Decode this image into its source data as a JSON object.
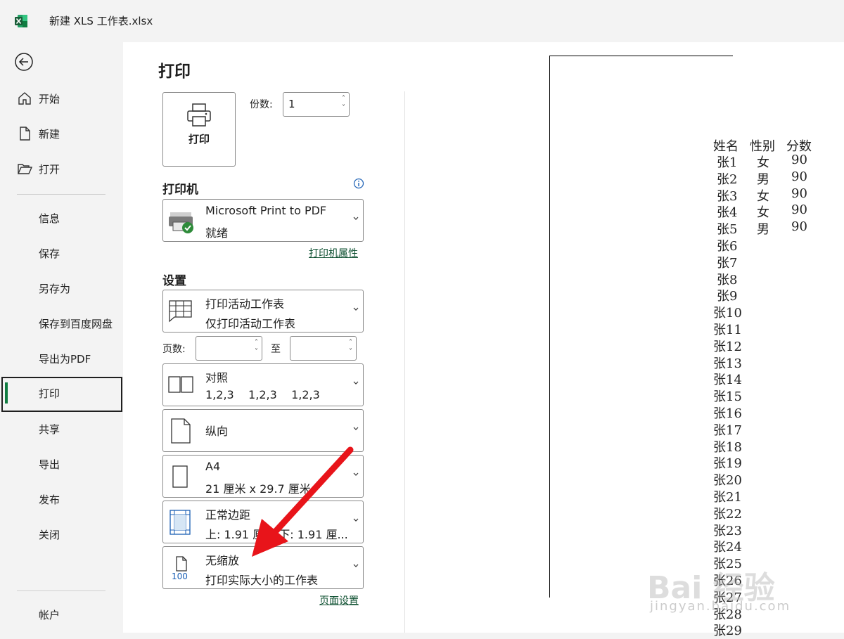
{
  "window": {
    "title": "新建 XLS 工作表.xlsx"
  },
  "sidebar": {
    "top_items": [
      {
        "label": "开始",
        "icon": "home-icon"
      },
      {
        "label": "新建",
        "icon": "new-file-icon"
      },
      {
        "label": "打开",
        "icon": "open-folder-icon"
      }
    ],
    "items": [
      "信息",
      "保存",
      "另存为",
      "保存到百度网盘",
      "导出为PDF",
      "打印",
      "共享",
      "导出",
      "发布",
      "关闭"
    ],
    "active": "打印",
    "account": "帐户"
  },
  "print": {
    "title": "打印",
    "button_label": "打印",
    "copies_label": "份数:",
    "copies_value": "1",
    "printer_heading": "打印机",
    "printer_name": "Microsoft Print to PDF",
    "printer_status": "就绪",
    "printer_properties_link": "打印机属性",
    "settings_heading": "设置",
    "what_line1": "打印活动工作表",
    "what_line2": "仅打印活动工作表",
    "pages_label": "页数:",
    "pages_to_label": "至",
    "collate_line1": "对照",
    "collate_line2": "1,2,3    1,2,3    1,2,3",
    "orientation": "纵向",
    "paper_line1": "A4",
    "paper_line2": "21 厘米 x 29.7 厘米",
    "margins_line1": "正常边距",
    "margins_line2": "上: 1.91 厘米 下: 1.91 厘...",
    "scaling_line1": "无缩放",
    "scaling_line2": "打印实际大小的工作表",
    "scaling_icon_text": "100",
    "page_setup_link": "页面设置"
  },
  "preview": {
    "headers": [
      "姓名",
      "性别",
      "分数"
    ],
    "rows": [
      [
        "张1",
        "女",
        "90"
      ],
      [
        "张2",
        "男",
        "90"
      ],
      [
        "张3",
        "女",
        "90"
      ],
      [
        "张4",
        "女",
        "90"
      ],
      [
        "张5",
        "男",
        "90"
      ],
      [
        "张6",
        "",
        ""
      ],
      [
        "张7",
        "",
        ""
      ],
      [
        "张8",
        "",
        ""
      ],
      [
        "张9",
        "",
        ""
      ],
      [
        "张10",
        "",
        ""
      ],
      [
        "张11",
        "",
        ""
      ],
      [
        "张12",
        "",
        ""
      ],
      [
        "张13",
        "",
        ""
      ],
      [
        "张14",
        "",
        ""
      ],
      [
        "张15",
        "",
        ""
      ],
      [
        "张16",
        "",
        ""
      ],
      [
        "张17",
        "",
        ""
      ],
      [
        "张18",
        "",
        ""
      ],
      [
        "张19",
        "",
        ""
      ],
      [
        "张20",
        "",
        ""
      ],
      [
        "张21",
        "",
        ""
      ],
      [
        "张22",
        "",
        ""
      ],
      [
        "张23",
        "",
        ""
      ],
      [
        "张24",
        "",
        ""
      ],
      [
        "张25",
        "",
        ""
      ],
      [
        "张26",
        "",
        ""
      ],
      [
        "张27",
        "",
        ""
      ],
      [
        "张28",
        "",
        ""
      ],
      [
        "张29",
        "",
        ""
      ]
    ]
  },
  "watermark": {
    "text": "Bai 经验",
    "url": "jingyan.baidu.com"
  },
  "colors": {
    "accent": "#107c41",
    "arrow": "#e8141a"
  }
}
